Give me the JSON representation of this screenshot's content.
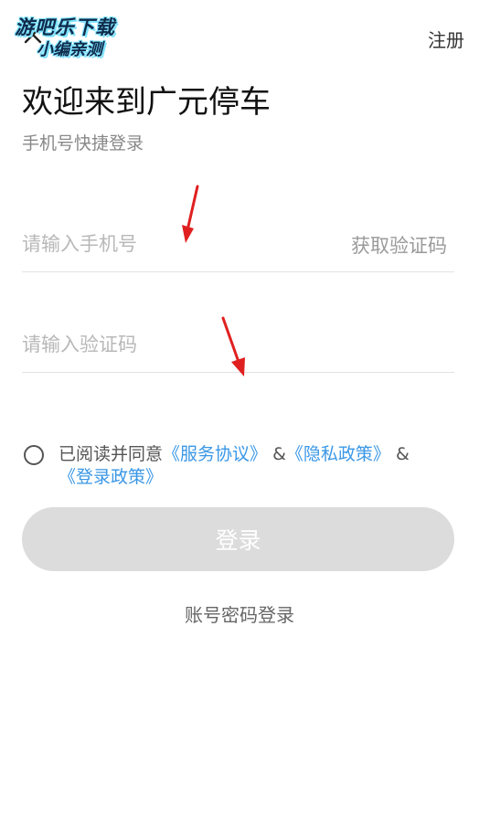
{
  "header": {
    "register_label": "注册",
    "close_icon": "close-icon"
  },
  "watermark": {
    "line1": "游吧乐下载",
    "line2": "小编亲测"
  },
  "title": "欢迎来到广元停车",
  "subtitle": "手机号快捷登录",
  "phone_field": {
    "placeholder": "请输入手机号",
    "value": "",
    "get_code_label": "获取验证码"
  },
  "code_field": {
    "placeholder": "请输入验证码",
    "value": ""
  },
  "agreement": {
    "checked": false,
    "prefix": "已阅读并同意",
    "service_link": "《服务协议》",
    "separator1": "&",
    "privacy_link": "《隐私政策》",
    "separator2": "&",
    "login_policy_link": "《登录政策》"
  },
  "login_button": {
    "label": "登录"
  },
  "password_login_label": "账号密码登录",
  "colors": {
    "link": "#3a97e6",
    "button_disabled": "#dcdcdc",
    "annotation_arrow": "#e02020"
  }
}
